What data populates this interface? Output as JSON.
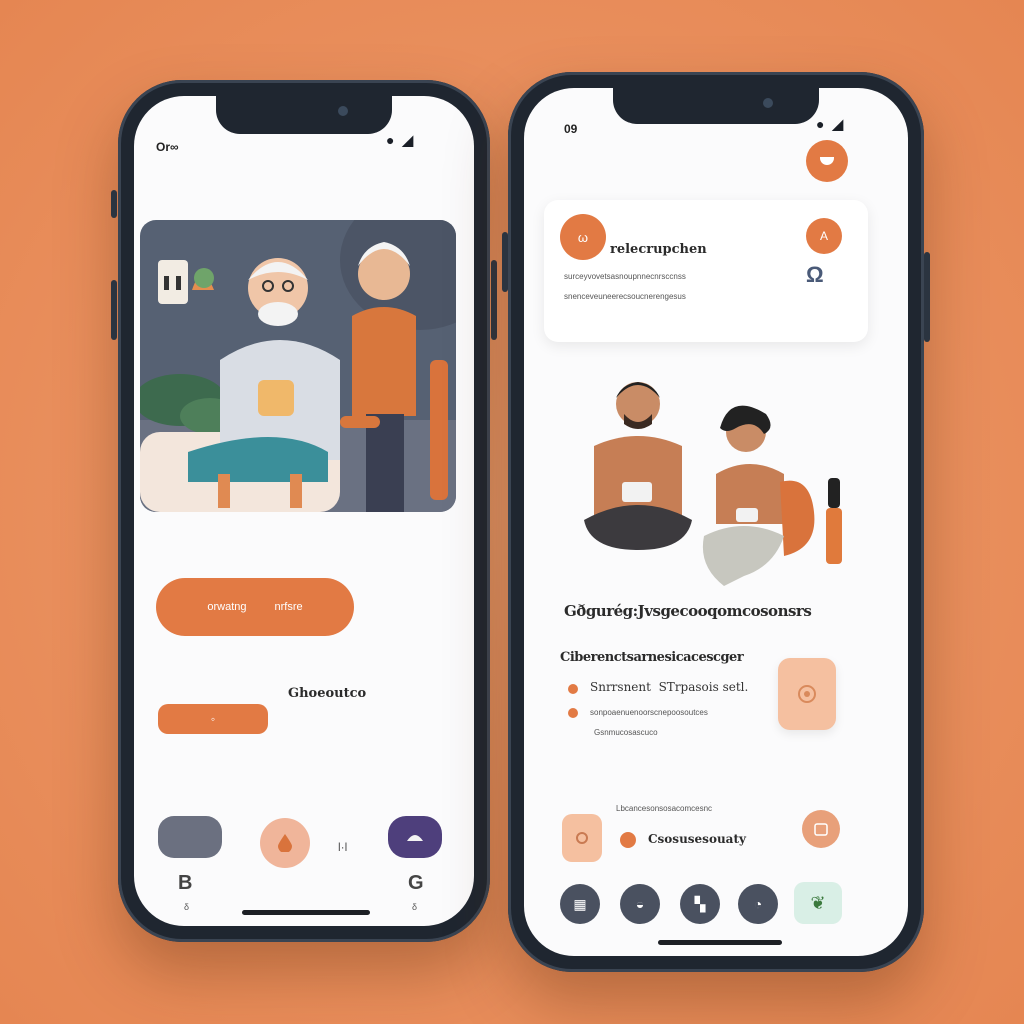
{
  "left_phone": {
    "status_time": "Or∞",
    "status_icons": "● ◢",
    "primary_button": {
      "left": "orwatng",
      "right": "nrfsre"
    },
    "secondary_label": "Ghoeoutco",
    "small_button_icon": "◦",
    "nav": {
      "mid_label": "l·l",
      "bottom_left_label": "B",
      "bottom_right_label": "G",
      "bottom_left_sub": "δ",
      "bottom_right_sub": "δ"
    },
    "colors": {
      "accent": "#e27a44",
      "peach": "#f0b59a",
      "slate": "#6b7080",
      "purple": "#4e3f7c"
    }
  },
  "right_phone": {
    "status_time": "09",
    "status_icons": "● ◢",
    "profile_card": {
      "title": "relecrupchen",
      "line1": "surceyvovetsasnoupnnecnrsccnss",
      "line2": "snenceveuneerecsoucnerengesus",
      "avatar_icon": "ω",
      "badge_icon": "A",
      "side_icon": "Ω"
    },
    "headline": "Gðgurég:Jvsgecooqomcosonsrs",
    "section": {
      "title": "Ciberenctsarnesicacescger",
      "item1": "Snrrsnent  STrpasois setl.",
      "item2": "sonpoaenuenoorscnepoosoutces",
      "item3": "Gsnmucosascuco"
    },
    "lower_card": {
      "caption": "Lbcancesonsosacomcesnc",
      "label": "Csosusesouaty"
    },
    "nav_icons": [
      "▦",
      "◒",
      "▚",
      "◔",
      "❦"
    ],
    "colors": {
      "accent": "#e27a44",
      "peach": "#f5c0a0",
      "mint": "#d9efe6"
    }
  }
}
